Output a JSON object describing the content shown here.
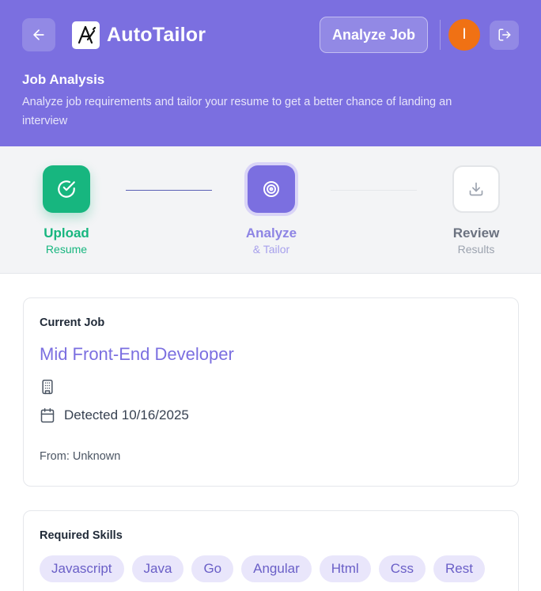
{
  "header": {
    "back_icon": "arrow-left-icon",
    "app_name": "AutoTailor",
    "analyze_button": "Analyze Job",
    "avatar_initial": "I",
    "logout_icon": "logout-icon",
    "title": "Job Analysis",
    "subtitle": "Analyze job requirements and tailor your resume to get a better chance of landing an interview"
  },
  "steps": [
    {
      "title": "Upload",
      "subtitle": "Resume",
      "state": "complete",
      "icon": "check-circle-icon"
    },
    {
      "title": "Analyze",
      "subtitle": "& Tailor",
      "state": "active",
      "icon": "target-icon"
    },
    {
      "title": "Review",
      "subtitle": "Results",
      "state": "pending",
      "icon": "download-icon"
    }
  ],
  "job": {
    "label": "Current Job",
    "title": "Mid Front-End Developer",
    "company_icon": "building-icon",
    "detected": "Detected 10/16/2025",
    "calendar_icon": "calendar-icon",
    "source": "From: Unknown"
  },
  "skills": {
    "label": "Required Skills",
    "items": [
      "Javascript",
      "Java",
      "Go",
      "Angular",
      "Html",
      "Css",
      "Rest"
    ]
  },
  "colors": {
    "brand": "#7b6fe0",
    "success": "#17b67f",
    "avatar": "#f07114",
    "chip_bg": "#e9e6fb",
    "chip_text": "#6a5fc7"
  }
}
